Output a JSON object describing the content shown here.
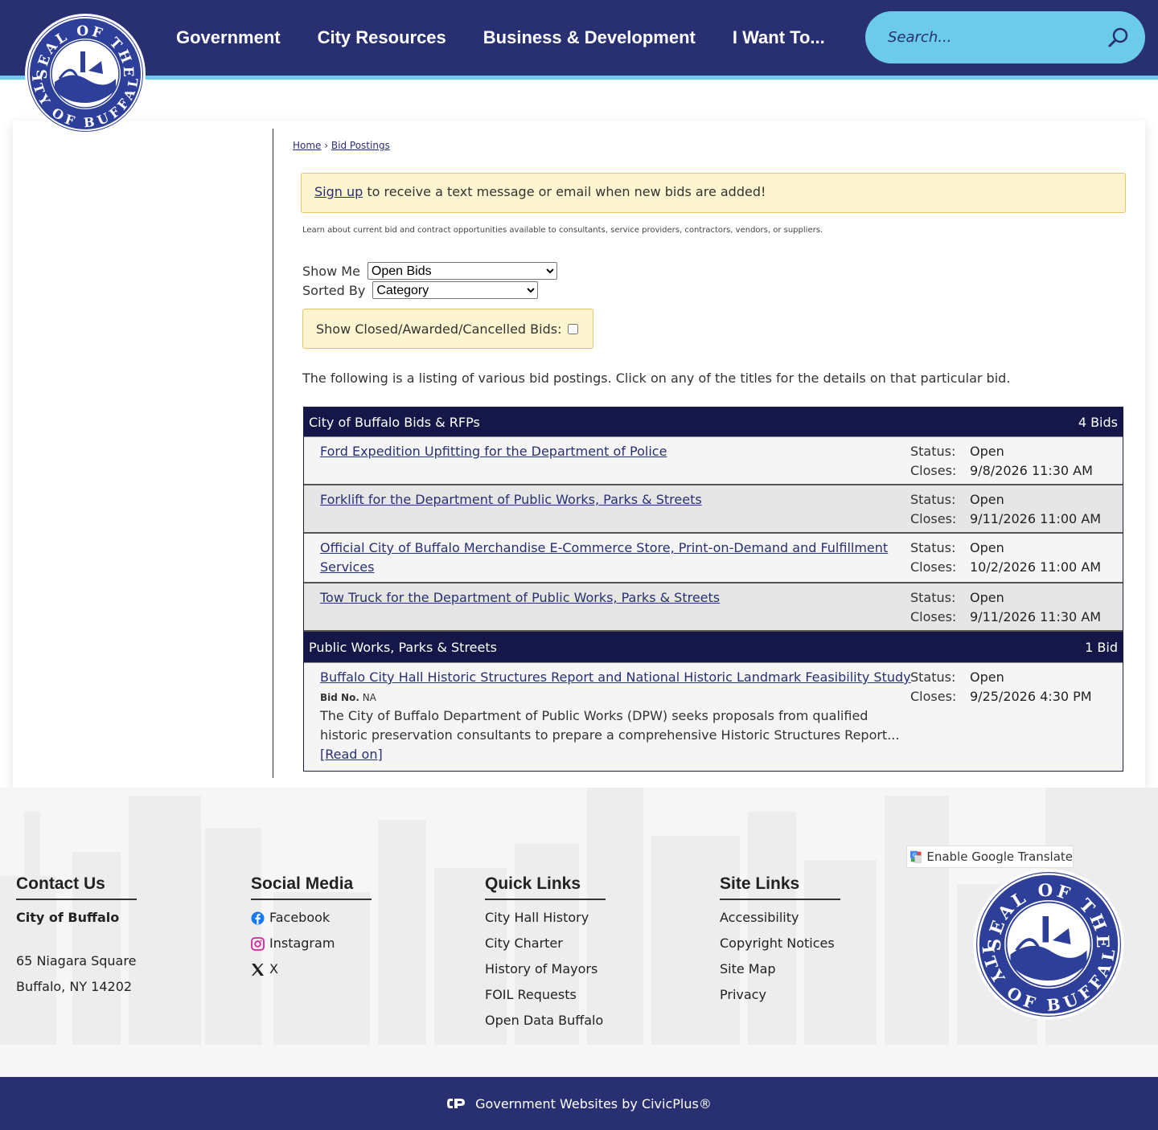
{
  "header": {
    "nav": [
      "Government",
      "City Resources",
      "Business & Development",
      "I Want To..."
    ],
    "search_placeholder": "Search...",
    "logo_text_top": "SEAL OF THE",
    "logo_text_bottom": "CITY OF BUFFALO",
    "colors": {
      "primary": "#283071",
      "accent": "#6ccbe8"
    }
  },
  "breadcrumb": {
    "home": "Home",
    "separator": "›",
    "current": "Bid Postings"
  },
  "alert": {
    "link": "Sign up",
    "text": " to receive a text message or email when new bids are added!"
  },
  "intro_small": "Learn about current bid and contract opportunities available to consultants, service providers, contractors, vendors, or suppliers.",
  "filters": {
    "show_me_label": "Show Me",
    "show_me_value": "Open Bids",
    "sorted_by_label": "Sorted By",
    "sorted_by_value": "Category",
    "closed_label": "Show Closed/Awarded/Cancelled Bids:"
  },
  "listing_intro": "The following is a listing of various bid postings. Click on any of the titles for the details on that particular bid.",
  "status_label": "Status:",
  "closes_label": "Closes:",
  "categories": [
    {
      "name": "City of Buffalo Bids & RFPs",
      "count": "4 Bids",
      "bids": [
        {
          "title": "Ford Expedition Upfitting for the Department of Police",
          "status": "Open",
          "closes": "9/8/2026 11:30 AM"
        },
        {
          "title": "Forklift for the Department of Public Works, Parks & Streets",
          "status": "Open",
          "closes": "9/11/2026 11:00 AM"
        },
        {
          "title": "Official City of Buffalo Merchandise E-Commerce Store, Print-on-Demand and Fulfillment Services",
          "status": "Open",
          "closes": "10/2/2026 11:00 AM"
        },
        {
          "title": "Tow Truck for the Department of Public Works, Parks & Streets",
          "status": "Open",
          "closes": "9/11/2026 11:30 AM"
        }
      ]
    },
    {
      "name": "Public Works, Parks & Streets",
      "count": "1 Bid",
      "bids": [
        {
          "title": "Buffalo City Hall Historic Structures Report and National Historic Landmark Feasibility Study",
          "status": "Open",
          "closes": "9/25/2026 4:30 PM",
          "bid_no_label": "Bid No.",
          "bid_no": "NA",
          "description": "The City of Buffalo Department of Public Works (DPW) seeks proposals from qualified historic preservation consultants to prepare a comprehensive Historic Structures Report...",
          "read_on": "[Read on]"
        }
      ]
    }
  ],
  "footer": {
    "contact": {
      "heading": "Contact Us",
      "org": "City of Buffalo",
      "address1": "65 Niagara Square",
      "address2": "Buffalo, NY 14202"
    },
    "social": {
      "heading": "Social Media",
      "items": [
        "Facebook",
        "Instagram",
        "X"
      ]
    },
    "quick_links": {
      "heading": "Quick Links",
      "items": [
        "City Hall History",
        "City Charter",
        "History of Mayors",
        "FOIL Requests",
        "Open Data Buffalo"
      ]
    },
    "site_links": {
      "heading": "Site Links",
      "items": [
        "Accessibility",
        "Copyright Notices",
        "Site Map",
        "Privacy"
      ]
    },
    "translate": "Enable Google Translate",
    "credit": "Government Websites by CivicPlus®"
  }
}
